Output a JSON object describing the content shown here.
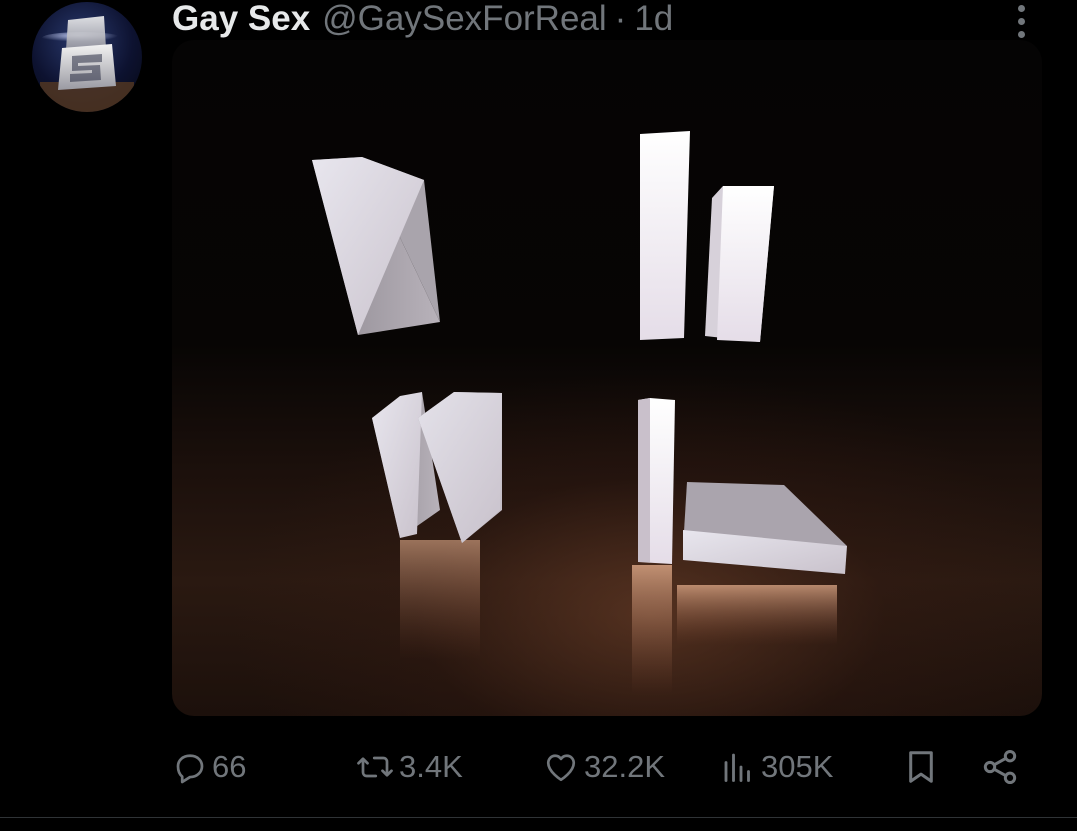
{
  "post": {
    "author": {
      "display_name": "Gay Sex",
      "handle": "@GaySexForReal",
      "avatar_icon": "gay-sex-logo-avatar"
    },
    "separator": "·",
    "timestamp": "1d",
    "media": {
      "type": "image",
      "description_icon": "3d-white-blocks-render"
    },
    "actions": {
      "reply": {
        "icon": "reply-icon",
        "count": "66"
      },
      "repost": {
        "icon": "repost-icon",
        "count": "3.4K"
      },
      "like": {
        "icon": "heart-icon",
        "count": "32.2K"
      },
      "views": {
        "icon": "views-icon",
        "count": "305K"
      },
      "bookmark": {
        "icon": "bookmark-icon"
      },
      "share": {
        "icon": "share-icon"
      }
    }
  },
  "colors": {
    "background": "#000000",
    "primary_text": "#e7e9ea",
    "secondary_text": "#71767b",
    "divider": "#2f3336"
  }
}
